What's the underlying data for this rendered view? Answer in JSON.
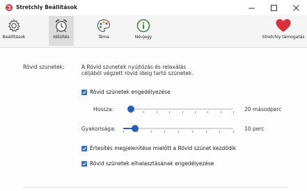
{
  "window": {
    "title": "Stretchly Beállítások",
    "minimize_icon": "minimize-icon",
    "maximize_icon": "maximize-icon",
    "close_icon": "close-icon"
  },
  "toolbar": {
    "items": [
      {
        "label": "Beállítások",
        "icon": "gear-icon"
      },
      {
        "label": "Időzítés",
        "icon": "alarm-clock-icon",
        "active": true
      },
      {
        "label": "Téma",
        "icon": "palette-icon"
      },
      {
        "label": "Névjegy",
        "icon": "info-icon"
      },
      {
        "label": "Stretchly támogatás",
        "icon": "heart-icon"
      }
    ]
  },
  "content": {
    "section_label": "Rövid szunetek:",
    "description_line1": "A Rövid szunetek nyújtózás és relaxálás",
    "description_line2": "céljából végzett rövid ideig tartó szünetek.",
    "enable_label": "Rövid szünetek engedélyezése",
    "enable_checked": true,
    "length_label": "Hossza:",
    "length_value": "20 másodperc",
    "length_fraction": 0.0,
    "frequency_label": "Gyakorisága:",
    "frequency_value": "10 perc",
    "frequency_fraction": 0.11,
    "notify_label": "Értesítés megjelenítése mielőtt a Rövid szünet kezdődik",
    "notify_checked": true,
    "postpone_label": "Rövid szünetek elhalasztásának engedélyezése",
    "postpone_checked": true
  },
  "colors": {
    "accent": "#1f5fbf",
    "checkbox": "#2e6fd8",
    "heart": "#d9303a",
    "active_tab": "#dcdcdc"
  }
}
